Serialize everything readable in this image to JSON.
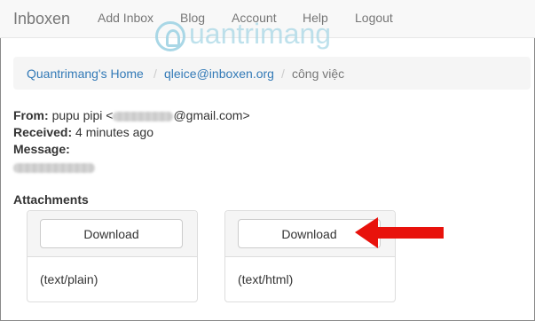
{
  "navbar": {
    "brand": "Inboxen",
    "links": [
      "Add Inbox",
      "Blog",
      "Account",
      "Help",
      "Logout"
    ]
  },
  "watermark": {
    "text": "uantrimang"
  },
  "breadcrumb": {
    "items": [
      "Quantrimang's Home",
      "qleice@inboxen.org",
      "công việc"
    ],
    "separator": "/"
  },
  "email": {
    "from_label": "From:",
    "from_name": "pupu pipi <",
    "from_suffix": "@gmail.com>",
    "received_label": "Received:",
    "received_value": "4 minutes ago",
    "message_label": "Message:"
  },
  "attachments": {
    "title": "Attachments",
    "items": [
      {
        "button_label": "Download",
        "type": "(text/plain)"
      },
      {
        "button_label": "Download",
        "type": "(text/html)"
      }
    ]
  },
  "colors": {
    "link": "#337ab7",
    "arrow": "#e8120c",
    "watermark": "#a9d7e6"
  }
}
